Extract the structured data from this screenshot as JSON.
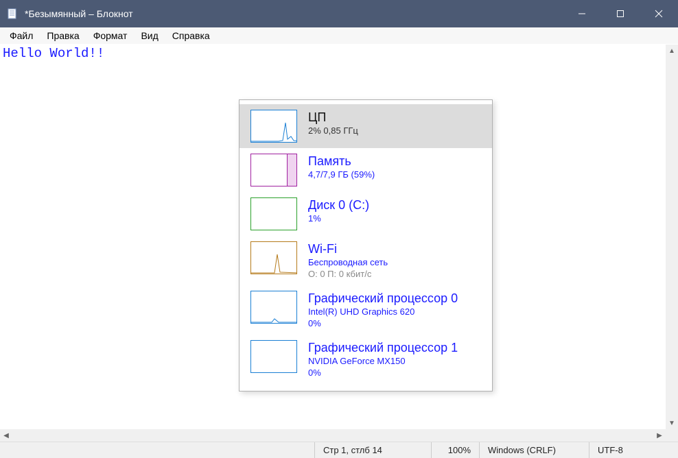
{
  "window": {
    "title": "*Безымянный – Блокнот"
  },
  "menu": {
    "items": [
      "Файл",
      "Правка",
      "Формат",
      "Вид",
      "Справка"
    ]
  },
  "editor": {
    "content": "Hello World!!"
  },
  "statusbar": {
    "position": "Стр 1, стлб 14",
    "zoom": "100%",
    "line_ending": "Windows (CRLF)",
    "encoding": "UTF-8"
  },
  "taskmgr": {
    "rows": [
      {
        "id": "cpu",
        "title": "ЦП",
        "sub": "2%  0,85 ГГц",
        "sub2": "",
        "percent": ""
      },
      {
        "id": "mem",
        "title": "Память",
        "sub": "4,7/7,9 ГБ (59%)",
        "sub2": "",
        "percent": ""
      },
      {
        "id": "disk",
        "title": "Диск 0 (C:)",
        "sub": "",
        "sub2": "",
        "percent": "1%"
      },
      {
        "id": "wifi",
        "title": "Wi-Fi",
        "sub": "Беспроводная сеть",
        "sub2": "О: 0 П: 0 кбит/с",
        "percent": ""
      },
      {
        "id": "gpu0",
        "title": "Графический процессор 0",
        "sub": "Intel(R) UHD Graphics 620",
        "sub2": "",
        "percent": "0%"
      },
      {
        "id": "gpu1",
        "title": "Графический процессор 1",
        "sub": "NVIDIA GeForce MX150",
        "sub2": "",
        "percent": "0%"
      }
    ]
  }
}
